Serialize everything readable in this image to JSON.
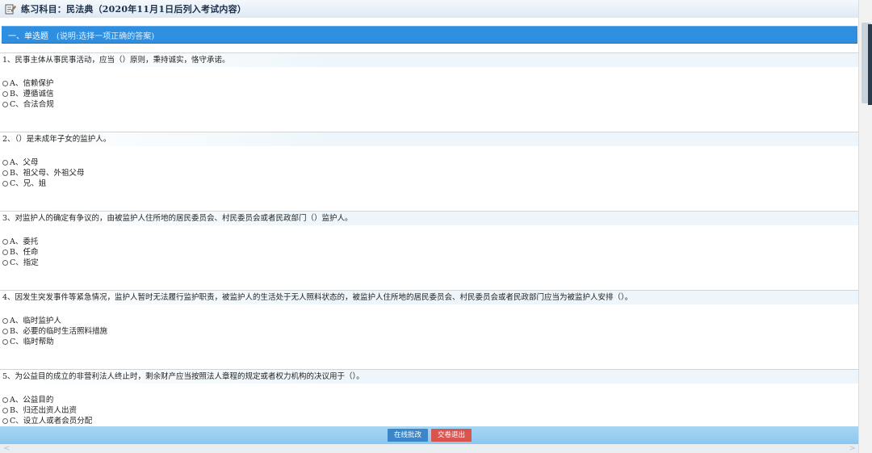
{
  "title": "练习科目：民法典（2020年11月1日后列入考试内容）",
  "section": {
    "title": "一、单选题",
    "note": "(说明:选择一项正确的答案)"
  },
  "questions": [
    {
      "text": "1、民事主体从事民事活动，应当（）原则，秉持诚实，恪守承诺。",
      "options": [
        "A、信赖保护",
        "B、遵循诚信",
        "C、合法合规"
      ]
    },
    {
      "text": "2、（）是未成年子女的监护人。",
      "options": [
        "A、父母",
        "B、祖父母、外祖父母",
        "C、兄、姐"
      ]
    },
    {
      "text": "3、对监护人的确定有争议的，由被监护人住所地的居民委员会、村民委员会或者民政部门（）监护人。",
      "options": [
        "A、委托",
        "B、任命",
        "C、指定"
      ]
    },
    {
      "text": "4、因发生突发事件等紧急情况，监护人暂时无法履行监护职责，被监护人的生活处于无人照料状态的，被监护人住所地的居民委员会、村民委员会或者民政部门应当为被监护人安排（）。",
      "options": [
        "A、临时监护人",
        "B、必要的临时生活照料措施",
        "C、临时帮助"
      ]
    },
    {
      "text": "5、为公益目的成立的非营利法人终止时，剩余财产应当按照法人章程的规定或者权力机构的决议用于（）。",
      "options": [
        "A、公益目的",
        "B、归还出资人出资",
        "C、设立人或者会员分配"
      ]
    }
  ],
  "buttons": {
    "submit_online": "在线批改",
    "submit_exit": "交卷退出"
  },
  "colors": {
    "section_header": "#2e8fe0",
    "bottom_bar": "#9ccff2",
    "btn_blue": "#3a86c8",
    "btn_red": "#d9534f"
  }
}
